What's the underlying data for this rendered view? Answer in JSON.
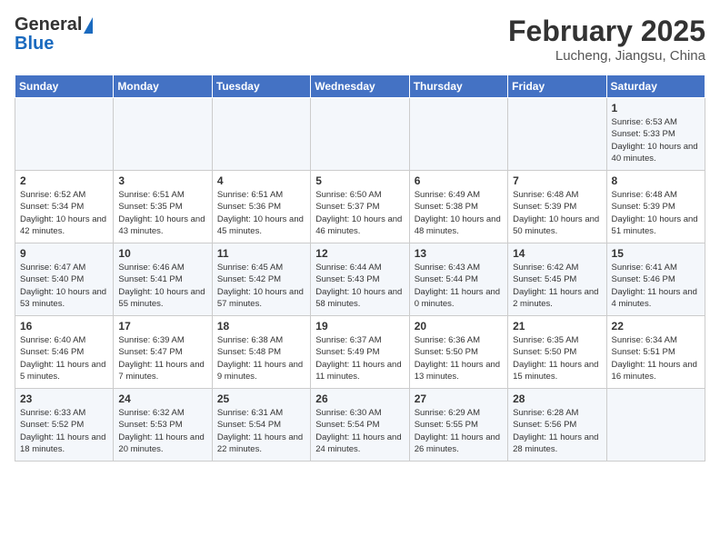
{
  "header": {
    "logo_general": "General",
    "logo_blue": "Blue",
    "month": "February 2025",
    "location": "Lucheng, Jiangsu, China"
  },
  "weekdays": [
    "Sunday",
    "Monday",
    "Tuesday",
    "Wednesday",
    "Thursday",
    "Friday",
    "Saturday"
  ],
  "weeks": [
    [
      {
        "day": "",
        "info": ""
      },
      {
        "day": "",
        "info": ""
      },
      {
        "day": "",
        "info": ""
      },
      {
        "day": "",
        "info": ""
      },
      {
        "day": "",
        "info": ""
      },
      {
        "day": "",
        "info": ""
      },
      {
        "day": "1",
        "info": "Sunrise: 6:53 AM\nSunset: 5:33 PM\nDaylight: 10 hours and 40 minutes."
      }
    ],
    [
      {
        "day": "2",
        "info": "Sunrise: 6:52 AM\nSunset: 5:34 PM\nDaylight: 10 hours and 42 minutes."
      },
      {
        "day": "3",
        "info": "Sunrise: 6:51 AM\nSunset: 5:35 PM\nDaylight: 10 hours and 43 minutes."
      },
      {
        "day": "4",
        "info": "Sunrise: 6:51 AM\nSunset: 5:36 PM\nDaylight: 10 hours and 45 minutes."
      },
      {
        "day": "5",
        "info": "Sunrise: 6:50 AM\nSunset: 5:37 PM\nDaylight: 10 hours and 46 minutes."
      },
      {
        "day": "6",
        "info": "Sunrise: 6:49 AM\nSunset: 5:38 PM\nDaylight: 10 hours and 48 minutes."
      },
      {
        "day": "7",
        "info": "Sunrise: 6:48 AM\nSunset: 5:39 PM\nDaylight: 10 hours and 50 minutes."
      },
      {
        "day": "8",
        "info": "Sunrise: 6:48 AM\nSunset: 5:39 PM\nDaylight: 10 hours and 51 minutes."
      }
    ],
    [
      {
        "day": "9",
        "info": "Sunrise: 6:47 AM\nSunset: 5:40 PM\nDaylight: 10 hours and 53 minutes."
      },
      {
        "day": "10",
        "info": "Sunrise: 6:46 AM\nSunset: 5:41 PM\nDaylight: 10 hours and 55 minutes."
      },
      {
        "day": "11",
        "info": "Sunrise: 6:45 AM\nSunset: 5:42 PM\nDaylight: 10 hours and 57 minutes."
      },
      {
        "day": "12",
        "info": "Sunrise: 6:44 AM\nSunset: 5:43 PM\nDaylight: 10 hours and 58 minutes."
      },
      {
        "day": "13",
        "info": "Sunrise: 6:43 AM\nSunset: 5:44 PM\nDaylight: 11 hours and 0 minutes."
      },
      {
        "day": "14",
        "info": "Sunrise: 6:42 AM\nSunset: 5:45 PM\nDaylight: 11 hours and 2 minutes."
      },
      {
        "day": "15",
        "info": "Sunrise: 6:41 AM\nSunset: 5:46 PM\nDaylight: 11 hours and 4 minutes."
      }
    ],
    [
      {
        "day": "16",
        "info": "Sunrise: 6:40 AM\nSunset: 5:46 PM\nDaylight: 11 hours and 5 minutes."
      },
      {
        "day": "17",
        "info": "Sunrise: 6:39 AM\nSunset: 5:47 PM\nDaylight: 11 hours and 7 minutes."
      },
      {
        "day": "18",
        "info": "Sunrise: 6:38 AM\nSunset: 5:48 PM\nDaylight: 11 hours and 9 minutes."
      },
      {
        "day": "19",
        "info": "Sunrise: 6:37 AM\nSunset: 5:49 PM\nDaylight: 11 hours and 11 minutes."
      },
      {
        "day": "20",
        "info": "Sunrise: 6:36 AM\nSunset: 5:50 PM\nDaylight: 11 hours and 13 minutes."
      },
      {
        "day": "21",
        "info": "Sunrise: 6:35 AM\nSunset: 5:50 PM\nDaylight: 11 hours and 15 minutes."
      },
      {
        "day": "22",
        "info": "Sunrise: 6:34 AM\nSunset: 5:51 PM\nDaylight: 11 hours and 16 minutes."
      }
    ],
    [
      {
        "day": "23",
        "info": "Sunrise: 6:33 AM\nSunset: 5:52 PM\nDaylight: 11 hours and 18 minutes."
      },
      {
        "day": "24",
        "info": "Sunrise: 6:32 AM\nSunset: 5:53 PM\nDaylight: 11 hours and 20 minutes."
      },
      {
        "day": "25",
        "info": "Sunrise: 6:31 AM\nSunset: 5:54 PM\nDaylight: 11 hours and 22 minutes."
      },
      {
        "day": "26",
        "info": "Sunrise: 6:30 AM\nSunset: 5:54 PM\nDaylight: 11 hours and 24 minutes."
      },
      {
        "day": "27",
        "info": "Sunrise: 6:29 AM\nSunset: 5:55 PM\nDaylight: 11 hours and 26 minutes."
      },
      {
        "day": "28",
        "info": "Sunrise: 6:28 AM\nSunset: 5:56 PM\nDaylight: 11 hours and 28 minutes."
      },
      {
        "day": "",
        "info": ""
      }
    ]
  ]
}
